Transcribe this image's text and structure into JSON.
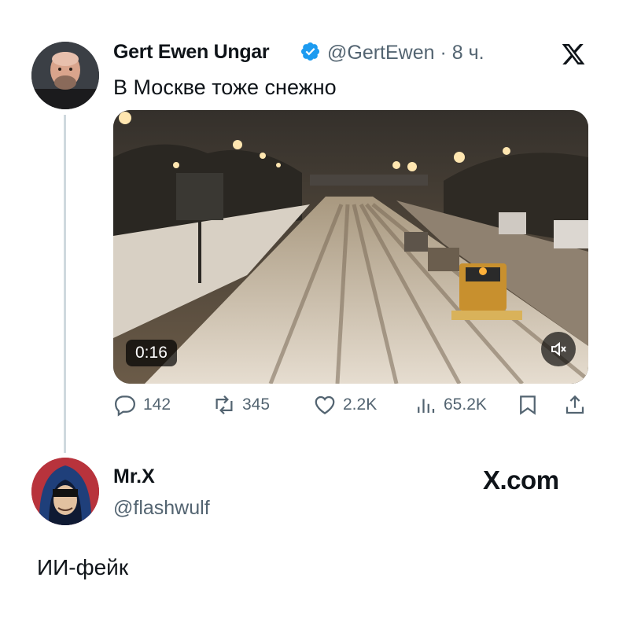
{
  "tweet": {
    "author_name": "Gert Ewen Ungar",
    "handle_time": "@GertEwen · 8 ч.",
    "text": "В Москве тоже снежно",
    "video": {
      "duration": "0:16",
      "icons": [
        "volume-muted-icon"
      ]
    },
    "actions": {
      "replies": "142",
      "reposts": "345",
      "likes": "2.2K",
      "views": "65.2K"
    },
    "icons": [
      "verified-badge-icon",
      "x-logo-icon",
      "reply-icon",
      "repost-icon",
      "like-icon",
      "views-icon",
      "bookmark-icon",
      "share-icon"
    ],
    "colors": {
      "verified": "#1d9bf0",
      "secondary_text": "#536471",
      "thread_line": "#cfd9de"
    }
  },
  "reply": {
    "author_name": "Mr.X",
    "handle": "@flashwulf",
    "watermark": "X.com",
    "text": "ИИ-фейк"
  }
}
